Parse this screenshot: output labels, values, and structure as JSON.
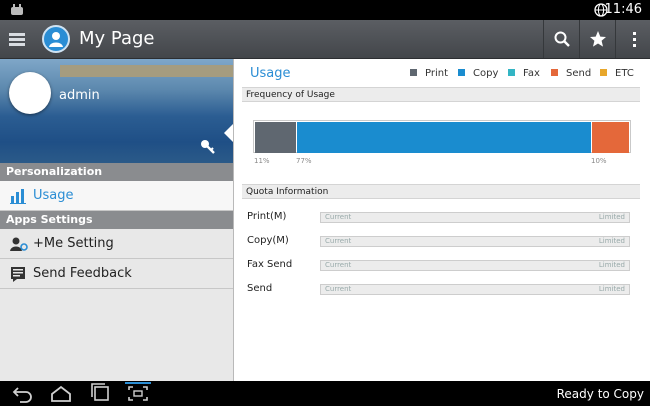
{
  "status_bar": {
    "time": "11:46"
  },
  "action_bar": {
    "title": "My Page",
    "icons": [
      "menu-icon",
      "app-logo-icon",
      "search-icon",
      "star-icon",
      "overflow-icon"
    ]
  },
  "sidebar": {
    "username": "admin",
    "section_personalization": "Personalization",
    "usage_label": "Usage",
    "section_apps": "Apps Settings",
    "me_setting_label": "+Me Setting",
    "feedback_label": "Send Feedback"
  },
  "main": {
    "usage_title": "Usage",
    "legend": [
      {
        "label": "Print",
        "color": "#5f6770"
      },
      {
        "label": "Copy",
        "color": "#1a8ccf"
      },
      {
        "label": "Fax",
        "color": "#33b5c4"
      },
      {
        "label": "Send",
        "color": "#e4683a"
      },
      {
        "label": "ETC",
        "color": "#e8a72b"
      }
    ],
    "frequency_header": "Frequency of Usage",
    "frequency": [
      {
        "type": "Print",
        "percent": 11,
        "label": "11%",
        "color": "#5f6770"
      },
      {
        "type": "Copy",
        "percent": 77,
        "label": "77%",
        "color": "#1a8ccf"
      },
      {
        "type": "Send",
        "percent": 10,
        "label": "10%",
        "color": "#e4683a"
      }
    ],
    "quota_header": "Quota Information",
    "quota": [
      {
        "label": "Print(M)",
        "current": "Current",
        "limited": "Limited"
      },
      {
        "label": "Copy(M)",
        "current": "Current",
        "limited": "Limited"
      },
      {
        "label": "Fax Send",
        "current": "Current",
        "limited": "Limited"
      },
      {
        "label": "Send",
        "current": "Current",
        "limited": "Limited"
      }
    ]
  },
  "nav_bar": {
    "status": "Ready to Copy"
  }
}
